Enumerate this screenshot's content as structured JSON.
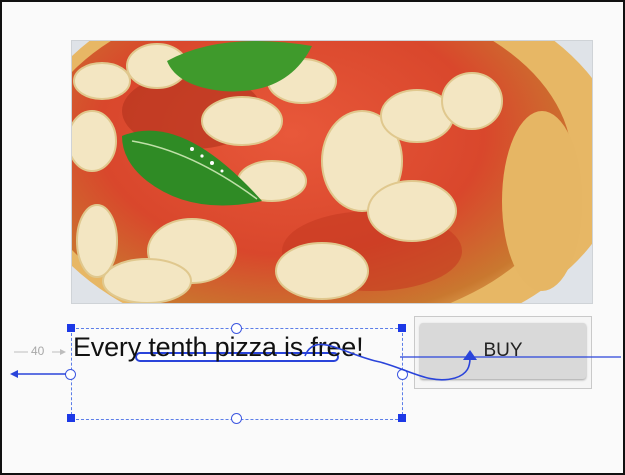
{
  "textview": {
    "text": "Every tenth pizza is free!"
  },
  "buy_button": {
    "label": "BUY"
  },
  "margin_indicator": {
    "value": "40"
  },
  "colors": {
    "selection_blue": "#1c38e6",
    "constraint_blue": "#3d57e0",
    "button_gray": "#d9d9d9"
  },
  "icons": [
    "constraint-handle-icon",
    "resize-handle-icon",
    "constraint-arrow-icon"
  ]
}
